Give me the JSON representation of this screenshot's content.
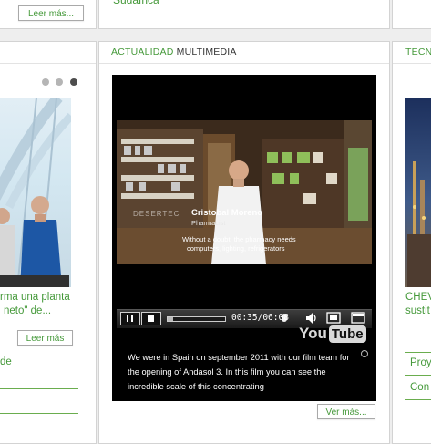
{
  "top_row": {
    "read_more_left": "Leer más...",
    "top_center_title_fragment": "Sudáfrica"
  },
  "left_panel": {
    "carousel_dots": 3,
    "active_dot": 3,
    "article_title_line1": "rma una planta",
    "article_title_line2": "neto\" de...",
    "read_more": "Leer más",
    "bottom_link_fragment": "de"
  },
  "center_panel": {
    "header_green": "ACTUALIDAD",
    "header_dark": "MULTIMEDIA",
    "video": {
      "caption_name": "Cristobal Moreno",
      "caption_role": "Pharmacist",
      "subtitle_line1": "Without a doubt, the pharmacy needs",
      "subtitle_line2": "computers, lighting, refrigerators",
      "watermark": "DESERTEC",
      "time": "00:35/06:08",
      "logo_you": "You",
      "logo_tube": "Tube",
      "progress_fraction": 0.095
    },
    "description": "We were in Spain on september 2011 with our film team for the opening of Andasol 3. In this film you can see the incredible scale of this concentrating",
    "see_more": "Ver más..."
  },
  "right_panel": {
    "header_fragment": "TECN",
    "article_title_line1": "CHEV",
    "article_title_line2": "sustit",
    "link1": "Proy",
    "link2": "Con"
  },
  "colors": {
    "brand_green": "#45993a",
    "panel_border": "#d3d3d3",
    "background": "#eeeeee",
    "player_bg": "#000000"
  }
}
